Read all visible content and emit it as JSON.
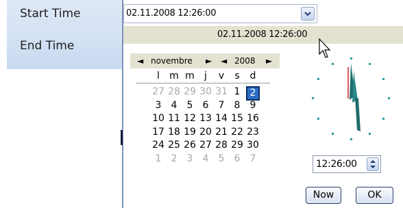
{
  "labels": {
    "start": "Start Time",
    "end": "End Time"
  },
  "start_input": {
    "value": "02.11.2008 12:26:00"
  },
  "header": {
    "value": "02.11.2008 12:26:00"
  },
  "calendar": {
    "month": "novembre",
    "year": "2008",
    "prev_month": "◄",
    "next_month": "►",
    "prev_year": "◄",
    "next_year": "►",
    "weekdays": [
      "l",
      "m",
      "m",
      "j",
      "v",
      "s",
      "d"
    ],
    "weeks": [
      [
        "27",
        "28",
        "29",
        "30",
        "31",
        "1",
        "2"
      ],
      [
        "3",
        "4",
        "5",
        "6",
        "7",
        "8",
        "9"
      ],
      [
        "10",
        "11",
        "12",
        "13",
        "14",
        "15",
        "16"
      ],
      [
        "17",
        "18",
        "19",
        "20",
        "21",
        "22",
        "23"
      ],
      [
        "24",
        "25",
        "26",
        "27",
        "28",
        "29",
        "30"
      ],
      [
        "1",
        "2",
        "3",
        "4",
        "5",
        "6",
        "7"
      ]
    ],
    "selected": "2"
  },
  "time": {
    "value": "12:26:00"
  },
  "buttons": {
    "now": "Now",
    "ok": "OK"
  },
  "colors": {
    "accent": "#2d6dc4",
    "clock_hand": "#1f6b6b",
    "second_hand": "#cc2222"
  }
}
